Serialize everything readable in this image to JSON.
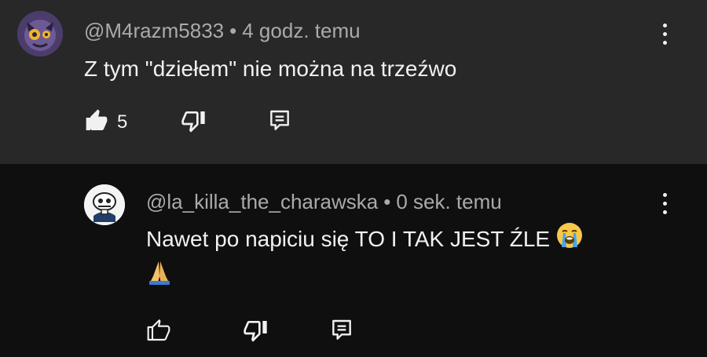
{
  "comments": [
    {
      "author": "@M4razm5833",
      "time": "4 godz. temu",
      "text": "Z tym \"dziełem\" nie można na trzeźwo",
      "likes": "5",
      "liked": true
    },
    {
      "author": "@la_killa_the_charawska",
      "time": "0 sek. temu",
      "text": "Nawet po napiciu się TO I TAK JEST ŹLE",
      "emoji_line1": "😭",
      "emoji_line2": "🙏",
      "likes": "",
      "liked": false
    }
  ],
  "separator": "•",
  "colors": {
    "top_comment_bg": "#282828",
    "reply_bg": "#0f0f0f",
    "meta_text": "#aaaaaa",
    "primary_text": "#f1f1f1"
  },
  "icons": [
    "thumbs-up-icon",
    "thumbs-down-icon",
    "reply-icon",
    "more-vert-icon"
  ]
}
